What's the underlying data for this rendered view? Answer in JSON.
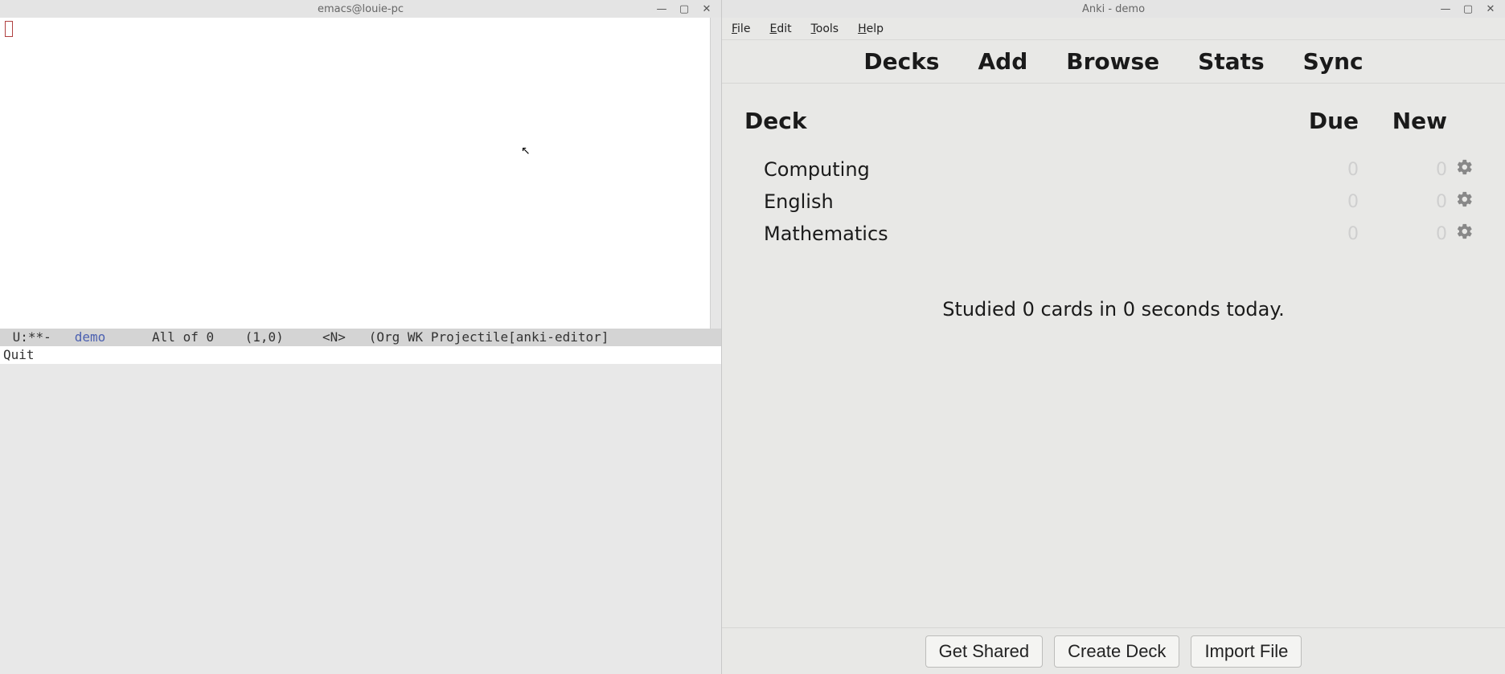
{
  "emacs": {
    "title": "emacs@louie-pc",
    "modeline": {
      "prefix": " U:**-   ",
      "buffer": "demo",
      "after_buffer": "      All of 0    (1,0)     <N>   (Org WK Projectile[anki-editor]"
    },
    "minibuffer": "Quit"
  },
  "anki": {
    "title": "Anki - demo",
    "menu": {
      "file": "File",
      "edit": "Edit",
      "tools": "Tools",
      "help": "Help"
    },
    "toolbar": {
      "decks": "Decks",
      "add": "Add",
      "browse": "Browse",
      "stats": "Stats",
      "sync": "Sync"
    },
    "headers": {
      "deck": "Deck",
      "due": "Due",
      "new": "New"
    },
    "decks": [
      {
        "name": "Computing",
        "due": "0",
        "new": "0"
      },
      {
        "name": "English",
        "due": "0",
        "new": "0"
      },
      {
        "name": "Mathematics",
        "due": "0",
        "new": "0"
      }
    ],
    "status": "Studied 0 cards in 0 seconds today.",
    "footer": {
      "get_shared": "Get Shared",
      "create_deck": "Create Deck",
      "import_file": "Import File"
    }
  }
}
